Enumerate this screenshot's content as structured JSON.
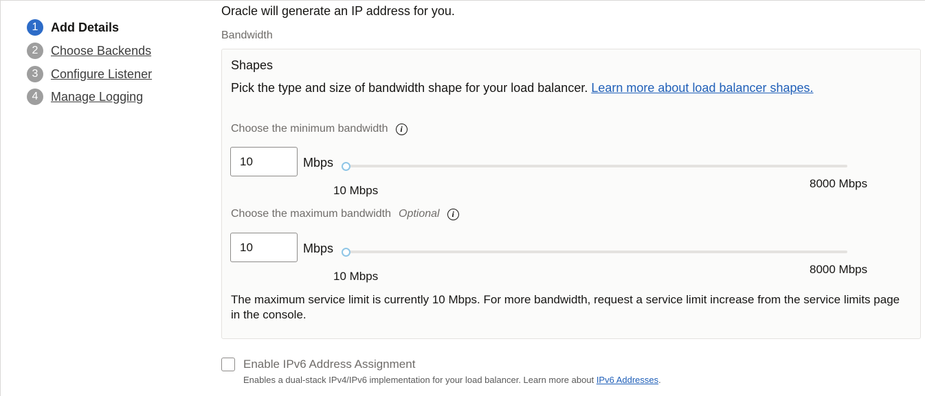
{
  "steps": [
    {
      "number": "1",
      "label": "Add Details"
    },
    {
      "number": "2",
      "label": "Choose Backends"
    },
    {
      "number": "3",
      "label": "Configure Listener"
    },
    {
      "number": "4",
      "label": "Manage Logging"
    }
  ],
  "main": {
    "ip_note": "Oracle will generate an IP address for you.",
    "bandwidth_label": "Bandwidth",
    "shapes": {
      "title": "Shapes",
      "description": "Pick the type and size of bandwidth shape for your load balancer.",
      "learn_more_link": "Learn more about load balancer shapes."
    },
    "min_bandwidth": {
      "label": "Choose the minimum bandwidth",
      "value": "10",
      "unit": "Mbps",
      "range_min_label": "10 Mbps",
      "range_max_label": "8000 Mbps",
      "slider_fraction": 0
    },
    "max_bandwidth": {
      "label": "Choose the maximum bandwidth",
      "optional_label": "Optional",
      "value": "10",
      "unit": "Mbps",
      "range_min_label": "10 Mbps",
      "range_max_label": "8000 Mbps",
      "slider_fraction": 0
    },
    "limit_note": "The maximum service limit is currently 10 Mbps. For more bandwidth, request a service limit increase from the service limits page in the console.",
    "ipv6": {
      "label": "Enable IPv6 Address Assignment",
      "checked": false,
      "help_text": "Enables a dual-stack IPv4/IPv6 implementation for your load balancer. Learn more about",
      "help_link": "IPv6 Addresses",
      "help_suffix": "."
    }
  },
  "colors": {
    "active_step": "#2d6cc8",
    "inactive_step": "#9e9e9e",
    "link": "#1f5fb8",
    "slider_thumb": "#8fc6e6"
  },
  "icons": {
    "info": "info-icon"
  }
}
